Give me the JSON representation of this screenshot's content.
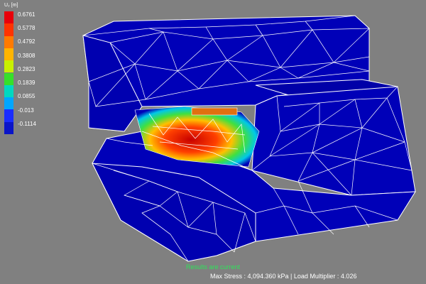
{
  "legend": {
    "title": "U₂ [m]",
    "colors": [
      "#e8000a",
      "#ff3300",
      "#ff7a00",
      "#ffb400",
      "#c8f000",
      "#36e02a",
      "#00d8c0",
      "#00a6ff",
      "#1a2cff",
      "#0a14c8"
    ],
    "labels": [
      "0.6761",
      "0.5778",
      "0.4792",
      "0.3808",
      "0.2823",
      "0.1839",
      "0.0855",
      "-0.013",
      "-0.1114"
    ]
  },
  "status": {
    "current": "Results are current",
    "stress": "Max Stress : 4,094.360 kPa | Load Multiplier : 4.026"
  },
  "colors": {
    "background": "#808080",
    "mesh_fill": "#0000b8",
    "mesh_line": "#ffffff"
  }
}
